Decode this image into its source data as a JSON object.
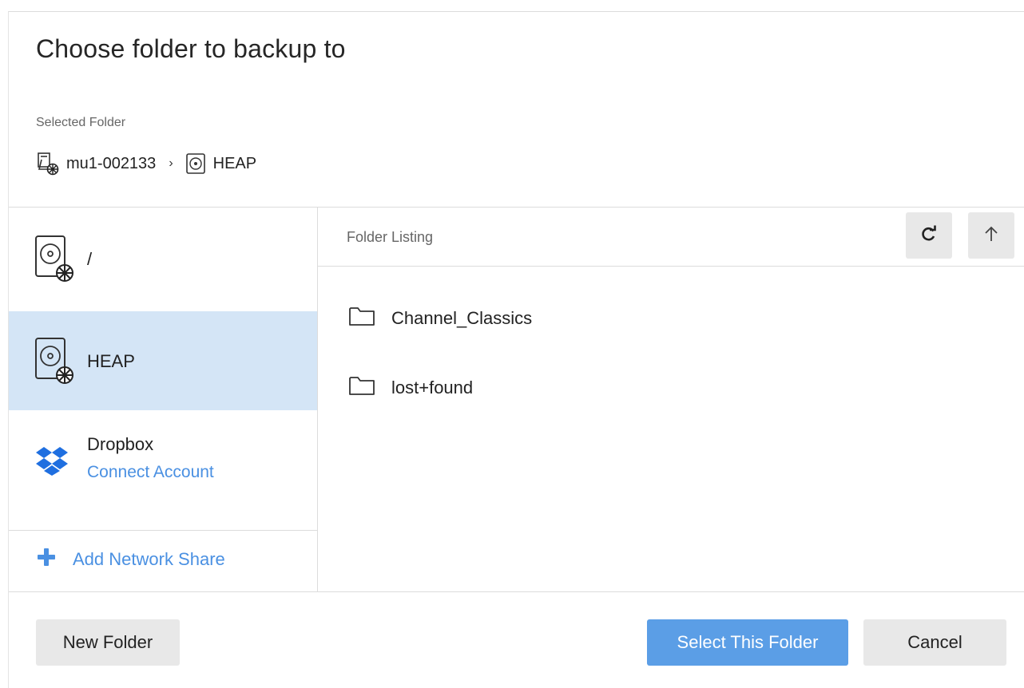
{
  "dialog": {
    "title": "Choose folder to backup to",
    "selected_label": "Selected Folder"
  },
  "breadcrumb": [
    {
      "label": "mu1-002133",
      "icon": "computer-network-icon"
    },
    {
      "label": "HEAP",
      "icon": "drive-icon"
    }
  ],
  "breadcrumb_separator": "›",
  "sidebar": {
    "items": [
      {
        "label": "/",
        "icon": "network-drive-icon",
        "selected": false
      },
      {
        "label": "HEAP",
        "icon": "network-drive-icon",
        "selected": true
      },
      {
        "label": "Dropbox",
        "sublabel": "Connect Account",
        "icon": "dropbox-icon",
        "selected": false
      }
    ],
    "add_share": "Add Network Share"
  },
  "listing": {
    "header": "Folder Listing",
    "folders": [
      "Channel_Classics",
      "lost+found"
    ]
  },
  "footer": {
    "new_folder": "New Folder",
    "select": "Select This Folder",
    "cancel": "Cancel"
  },
  "colors": {
    "accent": "#4a90e2",
    "primary_button": "#5b9ee6",
    "selected_row": "#d4e5f6",
    "button_gray": "#e8e8e8"
  }
}
